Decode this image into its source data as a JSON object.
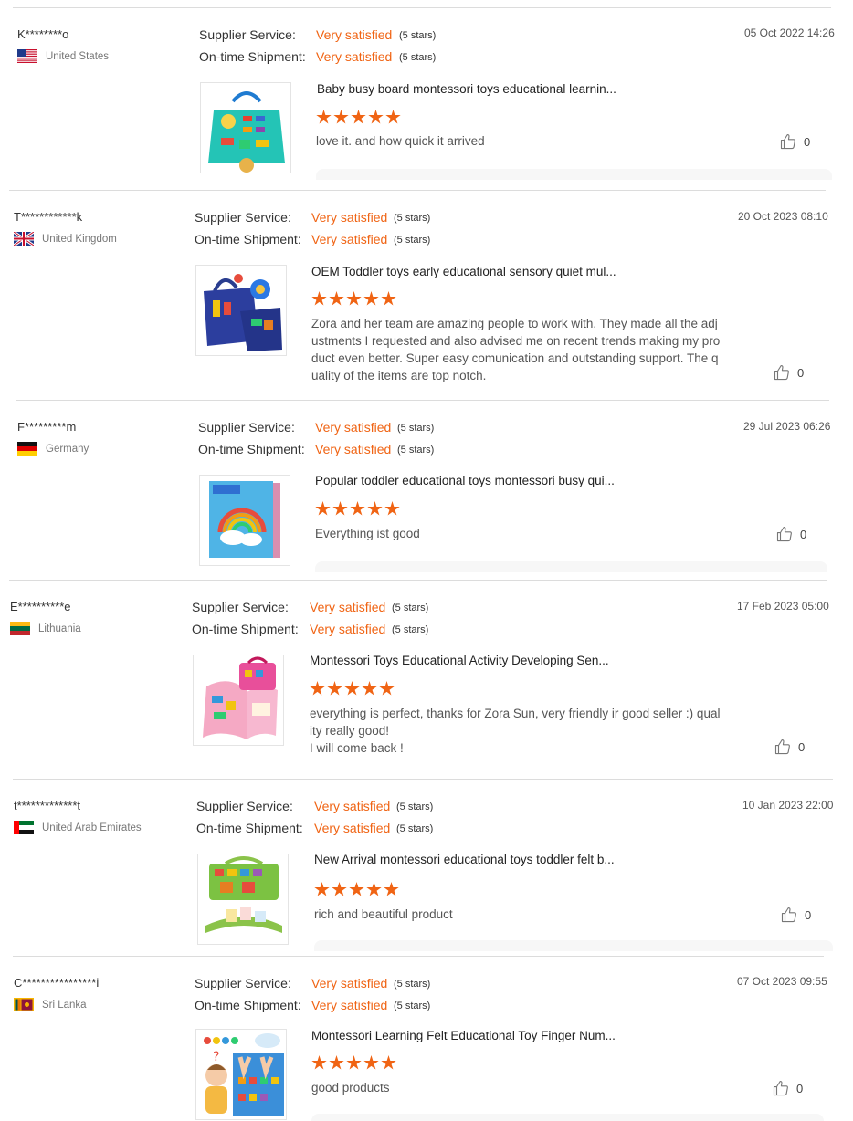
{
  "labels": {
    "supplier_service": "Supplier Service:",
    "ontime_shipment": "On-time Shipment:"
  },
  "reviews": [
    {
      "user": "K********o",
      "country": "United States",
      "flag": "us-flag-icon",
      "supplier_rating": "Very satisfied",
      "supplier_stars": "(5 stars)",
      "shipment_rating": "Very satisfied",
      "shipment_stars": "(5 stars)",
      "date": "05 Oct 2022 14:26",
      "product_title": "Baby busy board montessori toys educational learnin...",
      "rating": 5,
      "comment": "love it. and how quick it arrived",
      "likes": "0"
    },
    {
      "user": "T************k",
      "country": "United Kingdom",
      "flag": "uk-flag-icon",
      "supplier_rating": "Very satisfied",
      "supplier_stars": "(5 stars)",
      "shipment_rating": "Very satisfied",
      "shipment_stars": "(5 stars)",
      "date": "20 Oct 2023 08:10",
      "product_title": "OEM Toddler toys early educational sensory quiet mul...",
      "rating": 5,
      "comment": "Zora and her team are amazing people to work with. They made all the adjustments I requested and also advised me on recent trends making my product even better. Super easy comunication and outstanding support. The quality of the items are top notch.",
      "likes": "0"
    },
    {
      "user": "F*********m",
      "country": "Germany",
      "flag": "germany-flag-icon",
      "supplier_rating": "Very satisfied",
      "supplier_stars": "(5 stars)",
      "shipment_rating": "Very satisfied",
      "shipment_stars": "(5 stars)",
      "date": "29 Jul 2023 06:26",
      "product_title": "Popular toddler educational toys montessori busy qui...",
      "rating": 5,
      "comment": "Everything ist good",
      "likes": "0"
    },
    {
      "user": "E**********e",
      "country": "Lithuania",
      "flag": "lithuania-flag-icon",
      "supplier_rating": "Very satisfied",
      "supplier_stars": "(5 stars)",
      "shipment_rating": "Very satisfied",
      "shipment_stars": "(5 stars)",
      "date": "17 Feb 2023 05:00",
      "product_title": "Montessori Toys Educational Activity Developing Sen...",
      "rating": 5,
      "comment": "everything is perfect, thanks for Zora Sun, very friendly ir good seller :) quality really good!",
      "comment2": "I will come back !",
      "likes": "0"
    },
    {
      "user": "t*************t",
      "country": "United Arab Emirates",
      "flag": "uae-flag-icon",
      "supplier_rating": "Very satisfied",
      "supplier_stars": "(5 stars)",
      "shipment_rating": "Very satisfied",
      "shipment_stars": "(5 stars)",
      "date": "10 Jan 2023 22:00",
      "product_title": "New Arrival montessori educational toys toddler felt b...",
      "rating": 5,
      "comment": "rich and beautiful product",
      "likes": "0"
    },
    {
      "user": "C****************i",
      "country": "Sri Lanka",
      "flag": "sri-lanka-flag-icon",
      "supplier_rating": "Very satisfied",
      "supplier_stars": "(5 stars)",
      "shipment_rating": "Very satisfied",
      "shipment_stars": "(5 stars)",
      "date": "07 Oct 2023 09:55",
      "product_title": "Montessori Learning Felt Educational Toy Finger Num...",
      "rating": 5,
      "comment": "good products",
      "likes": "0"
    }
  ],
  "colors": {
    "accent": "#f06414",
    "divider": "#dcdcdc"
  }
}
